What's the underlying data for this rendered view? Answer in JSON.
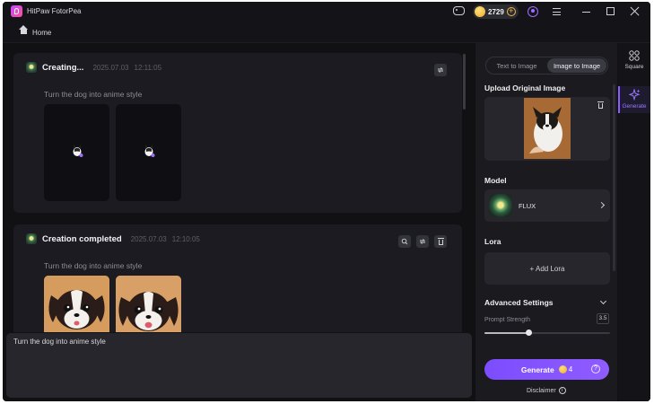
{
  "app": {
    "title": "HitPaw FotorPea"
  },
  "titlebar": {
    "coins": "2729"
  },
  "breadcrumb": {
    "home_label": "Home"
  },
  "feed": {
    "cards": [
      {
        "title": "Creating...",
        "date": "2025.07.03",
        "time": "12:11:05",
        "prompt": "Turn the dog into anime style",
        "status": "generating"
      },
      {
        "title": "Creation completed",
        "date": "2025.07.03",
        "time": "12:10:05",
        "prompt": "Turn the dog into anime style",
        "status": "completed"
      }
    ]
  },
  "input": {
    "value": "Turn the dog into anime style"
  },
  "panel": {
    "tabs": [
      {
        "label": "Text to Image",
        "active": false
      },
      {
        "label": "Image to Image",
        "active": true
      }
    ],
    "upload_label": "Upload Original Image",
    "model_label": "Model",
    "model_name": "FLUX",
    "lora_label": "Lora",
    "add_lora": "+ Add Lora",
    "advanced_label": "Advanced Settings",
    "prompt_strength_label": "Prompt Strength",
    "prompt_strength_value": "3.5",
    "prompt_strength_fraction": 0.35,
    "generate_label": "Generate",
    "generate_cost": "4",
    "disclaimer": "Disclaimer"
  },
  "nav": {
    "items": [
      {
        "label": "Square",
        "icon": "grid-icon",
        "active": false
      },
      {
        "label": "Generate",
        "icon": "sparkle-icon",
        "active": true
      }
    ]
  },
  "colors": {
    "accent": "#8b5cff",
    "coin": "#f0b64a",
    "background": "#111114",
    "panel": "#1a1a1f"
  }
}
